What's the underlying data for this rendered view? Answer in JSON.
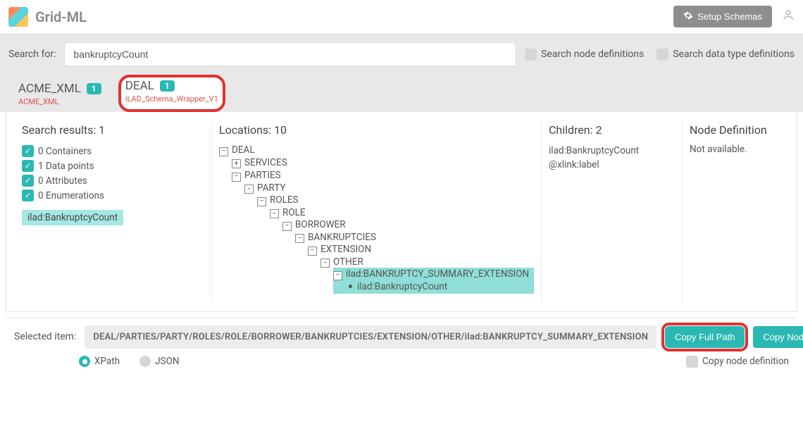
{
  "header": {
    "brand": "Grid-ML",
    "setup_btn": "Setup Schemas"
  },
  "search": {
    "label": "Search for:",
    "value": "bankruptcyCount",
    "opt_nodes": "Search node definitions",
    "opt_types": "Search data type definitions"
  },
  "tabs": [
    {
      "title": "ACME_XML",
      "badge": "1",
      "sub": "ACME_XML",
      "active": false
    },
    {
      "title": "DEAL",
      "badge": "1",
      "sub": "iLAD_Schema_Wrapper_V1",
      "active": true,
      "ring": true
    }
  ],
  "results": {
    "heading": "Search results: 1",
    "facets": [
      "0 Containers",
      "1 Data points",
      "0 Attributes",
      "0 Enumerations"
    ],
    "item": "ilad:BankruptcyCount"
  },
  "locations": {
    "heading": "Locations: 10",
    "tree": [
      "DEAL",
      "SERVICES",
      "PARTIES",
      "PARTY",
      "ROLES",
      "ROLE",
      "BORROWER",
      "BANKRUPTCIES",
      "EXTENSION",
      "OTHER",
      "ilad:BANKRUPTCY_SUMMARY_EXTENSION",
      "ilad:BankruptcyCount"
    ]
  },
  "children": {
    "heading": "Children: 2",
    "items": [
      "ilad:BankruptcyCount",
      "@xlink:label"
    ]
  },
  "nodedef": {
    "heading": "Node Definition",
    "text": "Not available."
  },
  "selected": {
    "label": "Selected item:",
    "path": "DEAL/PARTIES/PARTY/ROLES/ROLE/BORROWER/BANKRUPTCIES/EXTENSION/OTHER/ilad:BANKRUPTCY_SUMMARY_EXTENSION",
    "copy_full": "Copy Full Path",
    "copy_name": "Copy Node Name",
    "copy_def": "Copy node definition",
    "fmt_xpath": "XPath",
    "fmt_json": "JSON"
  }
}
